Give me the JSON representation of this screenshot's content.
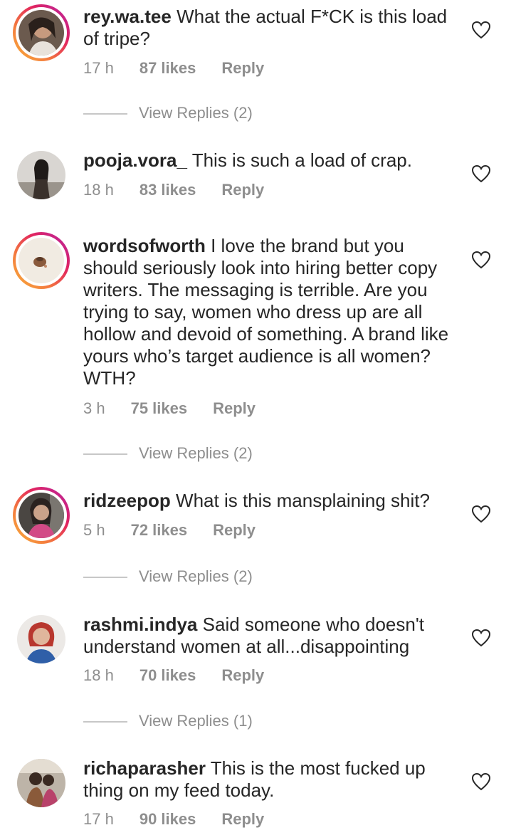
{
  "comments": [
    {
      "username": "rey.wa.tee",
      "text": "What the actual F*CK is this load of tripe?",
      "time": "17 h",
      "likes": "87 likes",
      "reply": "Reply",
      "view_replies": "View Replies (2)",
      "story_ring": true,
      "heart_icon": "heart-outline-icon"
    },
    {
      "username": "pooja.vora_",
      "text": "This is such a load of crap.",
      "time": "18 h",
      "likes": "83 likes",
      "reply": "Reply",
      "story_ring": false,
      "heart_icon": "heart-outline-icon"
    },
    {
      "username": "wordsofworth",
      "text": "I love the brand but you should seriously look into hiring better copy writers. The messaging is terrible. Are you trying to say, women who dress up are all hollow and devoid of something. A brand like yours who’s target audience is all women? WTH?",
      "time": "3 h",
      "likes": "75 likes",
      "reply": "Reply",
      "view_replies": "View Replies (2)",
      "story_ring": true,
      "heart_icon": "heart-outline-icon"
    },
    {
      "username": "ridzeepop",
      "text": "What is this mansplaining shit?",
      "time": "5 h",
      "likes": "72 likes",
      "reply": "Reply",
      "view_replies": "View Replies (2)",
      "story_ring": true,
      "heart_icon": "heart-outline-icon"
    },
    {
      "username": "rashmi.indya",
      "text": "Said someone who doesn't understand women at all...disappointing",
      "time": "18 h",
      "likes": "70 likes",
      "reply": "Reply",
      "view_replies": "View Replies (1)",
      "story_ring": false,
      "heart_icon": "heart-outline-icon"
    },
    {
      "username": "richaparasher",
      "text": "This is the most fucked up thing on my feed today.",
      "time": "17 h",
      "likes": "90 likes",
      "reply": "Reply",
      "story_ring": false,
      "heart_icon": "heart-outline-icon"
    }
  ],
  "colors": {
    "text": "#262626",
    "secondary": "#8e8e8e",
    "story_ring_start": "#f9b43a",
    "story_ring_end": "#b225a8"
  }
}
